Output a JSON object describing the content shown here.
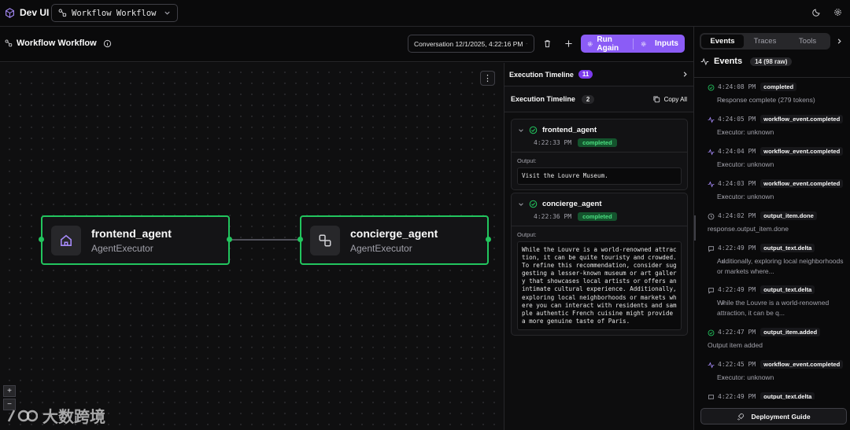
{
  "app": {
    "title": "Dev UI",
    "workflow_selector": "Workflow Workflow"
  },
  "toolbar": {
    "workflow_title": "Workflow Workflow",
    "conversation_label": "Conversation 12/1/2025, 4:22:16 PM",
    "run_again_label": "Run Again",
    "inputs_label": "Inputs"
  },
  "canvas": {
    "nodes": [
      {
        "name": "frontend_agent",
        "type": "AgentExecutor",
        "icon": "home-icon"
      },
      {
        "name": "concierge_agent",
        "type": "AgentExecutor",
        "icon": "route-icon"
      }
    ],
    "zoom_in": "+",
    "zoom_out": "−",
    "watermark": "大数跨境"
  },
  "timeline": {
    "header": "Execution Timeline",
    "header_count": "11",
    "sub_title": "Execution Timeline",
    "sub_count": "2",
    "copy_all": "Copy All",
    "output_label": "Output:",
    "items": [
      {
        "name": "frontend_agent",
        "time": "4:22:33 PM",
        "status": "completed",
        "output": "Visit the Louvre Museum."
      },
      {
        "name": "concierge_agent",
        "time": "4:22:36 PM",
        "status": "completed",
        "output": "While the Louvre is a world-renowned attrac\ntion, it can be quite touristy and crowded.\nTo refine this recommendation, consider sug\ngesting a lesser-known museum or art galler\ny that showcases local artists or offers an\nintimate cultural experience. Additionally,\nexploring local neighborhoods or markets wh\nere you can interact with residents and sam\nple authentic French cuisine might provide\na more genuine taste of Paris."
      }
    ]
  },
  "right_panel": {
    "tabs": [
      "Events",
      "Traces",
      "Tools"
    ],
    "active_tab": "Events",
    "events_title": "Events",
    "events_count": "14 (98 raw)",
    "deploy_label": "Deployment Guide",
    "events": [
      {
        "time": "4:24:08 PM",
        "type": "completed",
        "icon": "check-circle-icon",
        "detail": "Response complete (279 tokens)",
        "chevron": true
      },
      {
        "time": "4:24:05 PM",
        "type": "workflow_event.completed",
        "icon": "activity-icon",
        "detail": "Executor: unknown",
        "chevron": true
      },
      {
        "time": "4:24:04 PM",
        "type": "workflow_event.completed",
        "icon": "activity-icon",
        "detail": "Executor: unknown",
        "chevron": true
      },
      {
        "time": "4:24:03 PM",
        "type": "workflow_event.completed",
        "icon": "activity-icon",
        "detail": "Executor: unknown",
        "chevron": true
      },
      {
        "time": "4:24:02 PM",
        "type": "output_item.done",
        "icon": "clock-icon",
        "detail": "response.output_item.done",
        "chevron": false
      },
      {
        "time": "4:22:49 PM",
        "type": "output_text.delta",
        "icon": "message-icon",
        "detail": "Additionally, exploring local neighborhoods or markets where...",
        "chevron": true
      },
      {
        "time": "4:22:49 PM",
        "type": "output_text.delta",
        "icon": "message-icon",
        "detail": "While the Louvre is a world-renowned attraction, it can be q...",
        "chevron": true
      },
      {
        "time": "4:22:47 PM",
        "type": "output_item.added",
        "icon": "check-circle-icon",
        "detail": "Output item added",
        "chevron": false
      },
      {
        "time": "4:22:45 PM",
        "type": "workflow_event.completed",
        "icon": "activity-icon",
        "detail": "Executor: unknown",
        "chevron": true
      },
      {
        "time": "4:22:49 PM",
        "type": "output_text.delta",
        "icon": "message-icon",
        "detail": "",
        "chevron": false
      }
    ]
  },
  "colors": {
    "accent": "#8b5cf6",
    "success": "#22c55e",
    "background": "#0a0a0b"
  }
}
